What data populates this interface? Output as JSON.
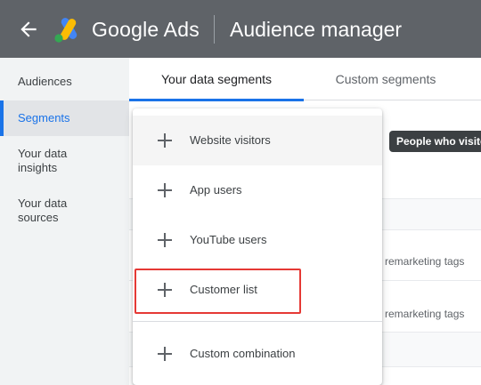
{
  "header": {
    "brand": "Google Ads",
    "title": "Audience manager",
    "back_icon": "arrow-back-icon",
    "logo_icon": "google-ads-logo",
    "background_color": "#5f6368"
  },
  "sidebar": {
    "items": [
      {
        "label": "Audiences",
        "active": false
      },
      {
        "label": "Segments",
        "active": true
      },
      {
        "label": "Your data\ninsights",
        "active": false
      },
      {
        "label": "Your data\nsources",
        "active": false
      }
    ]
  },
  "tabs": [
    {
      "label": "Your data segments",
      "active": true
    },
    {
      "label": "Custom segments",
      "active": false
    }
  ],
  "tooltip": {
    "text": "People who visite"
  },
  "table": {
    "rows": [
      {
        "text": "remarketing tags"
      },
      {
        "text": "remarketing tags"
      }
    ]
  },
  "menu": {
    "items": [
      {
        "label": "Website visitors",
        "icon": "plus-icon"
      },
      {
        "label": "App users",
        "icon": "plus-icon"
      },
      {
        "label": "YouTube users",
        "icon": "plus-icon"
      },
      {
        "label": "Customer list",
        "icon": "plus-icon",
        "highlighted": true
      },
      {
        "label": "Custom combination",
        "icon": "plus-icon"
      }
    ]
  },
  "colors": {
    "accent": "#1a73e8",
    "highlight_border": "#e53935"
  }
}
